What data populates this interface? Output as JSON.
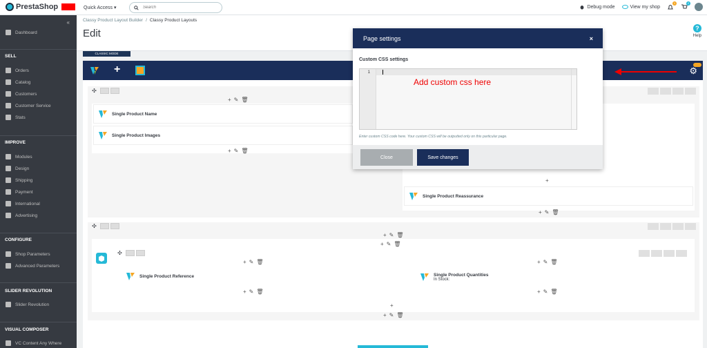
{
  "topbar": {
    "brand": "PrestaShop",
    "quick_access": "Quick Access ▾",
    "search_placeholder": "Search",
    "debug_mode": "Debug mode",
    "view_my_shop": "View my shop",
    "notif_badge_1": "1",
    "notif_badge_2": "2"
  },
  "sidebar": {
    "dashboard": "Dashboard",
    "sell_title": "SELL",
    "sell": [
      "Orders",
      "Catalog",
      "Customers",
      "Customer Service",
      "Stats"
    ],
    "improve_title": "IMPROVE",
    "improve": [
      "Modules",
      "Design",
      "Shipping",
      "Payment",
      "International",
      "Advertising"
    ],
    "configure_title": "CONFIGURE",
    "configure": [
      "Shop Parameters",
      "Advanced Parameters"
    ],
    "slider_title": "SLIDER REVOLUTION",
    "slider": [
      "Slider Revolution"
    ],
    "vc_title": "VISUAL COMPOSER",
    "vc": [
      "VC Content Any Where"
    ]
  },
  "header": {
    "breadcrumb_1": "Classy Product Layout Builder",
    "breadcrumb_sep": "/",
    "breadcrumb_2": "Classy Product Layouts",
    "title": "Edit",
    "help": "Help"
  },
  "composer": {
    "classic_mode": "CLASSIC MODE",
    "elements": {
      "name": "Single Product Name",
      "images": "Single Product Images",
      "reassurance": "Single Product Reassurance",
      "reference": "Single Product Reference",
      "quantities": "Single Product Quantities",
      "in_stock": "In Stock:"
    }
  },
  "modal": {
    "title": "Page settings",
    "close_x": "×",
    "section_label": "Custom CSS settings",
    "line_number": "1",
    "annotation": "Add custom css here",
    "help_text": "Enter custom CSS code here. Your custom CSS will be outputted only on this particular page.",
    "close_button": "Close",
    "save_button": "Save changes"
  },
  "colors": {
    "navy": "#1a2e5a",
    "accent": "#25b9d7",
    "sidebar": "#363a41",
    "annotation_red": "#ee0000"
  }
}
